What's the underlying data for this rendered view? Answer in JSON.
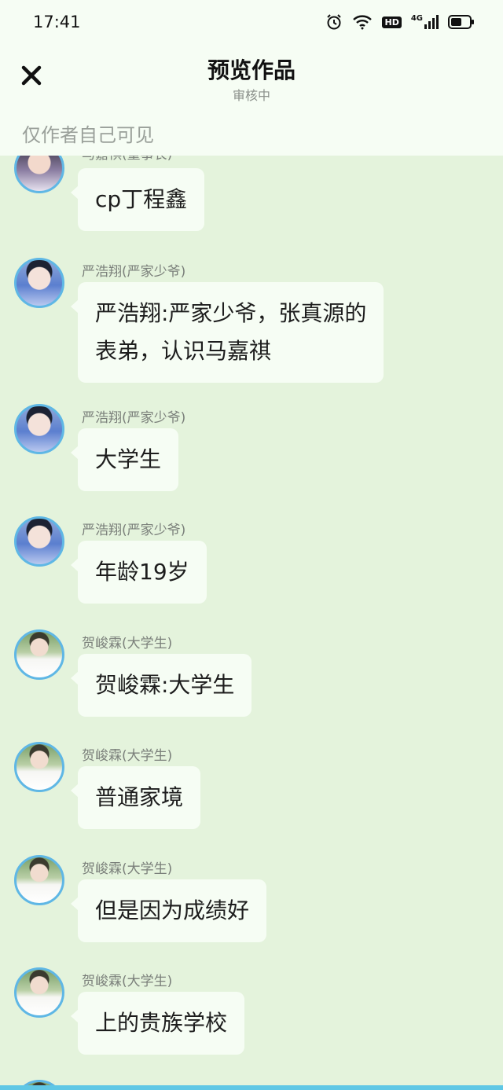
{
  "status_bar": {
    "time": "17:41",
    "icons": [
      "alarm-icon",
      "wifi-icon",
      "hd-icon",
      "signal-4g-icon",
      "battery-icon"
    ],
    "hd_label": "HD",
    "network_label": "4G"
  },
  "header": {
    "title": "预览作品",
    "subtitle": "审核中",
    "visibility_note": "仅作者自己可见"
  },
  "messages": [
    {
      "name": "马嘉祺(董事长)",
      "text": "cp丁程鑫",
      "avatar": "ma"
    },
    {
      "name": "严浩翔(严家少爷)",
      "text": "严浩翔:严家少爷，张真源的\n表弟，认识马嘉祺",
      "avatar": "yan"
    },
    {
      "name": "严浩翔(严家少爷)",
      "text": "大学生",
      "avatar": "yan"
    },
    {
      "name": "严浩翔(严家少爷)",
      "text": "年龄19岁",
      "avatar": "yan"
    },
    {
      "name": "贺峻霖(大学生)",
      "text": "贺峻霖:大学生",
      "avatar": "he"
    },
    {
      "name": "贺峻霖(大学生)",
      "text": "普通家境",
      "avatar": "he"
    },
    {
      "name": "贺峻霖(大学生)",
      "text": "但是因为成绩好",
      "avatar": "he"
    },
    {
      "name": "贺峻霖(大学生)",
      "text": "上的贵族学校",
      "avatar": "he"
    }
  ],
  "colors": {
    "background": "#e4f3dc",
    "header_bg": "#f6fdf4",
    "bubble_bg": "#f6fdf4",
    "avatar_ring": "#5fb7e5"
  }
}
